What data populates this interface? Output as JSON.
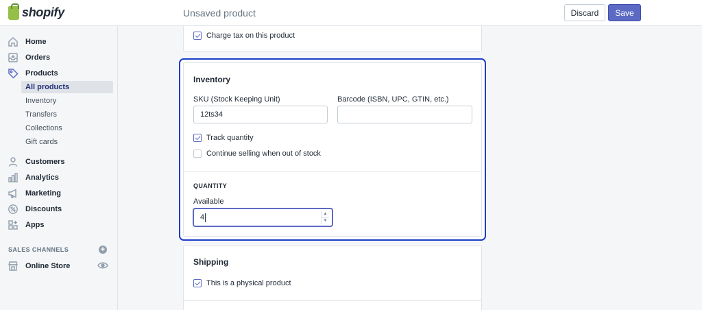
{
  "app": {
    "brand": "shopify",
    "page_title": "Unsaved product"
  },
  "actions": {
    "discard_label": "Discard",
    "save_label": "Save"
  },
  "sidebar": {
    "items": [
      {
        "label": "Home",
        "icon": "home-icon"
      },
      {
        "label": "Orders",
        "icon": "orders-icon"
      },
      {
        "label": "Products",
        "icon": "tag-icon"
      },
      {
        "label": "Customers",
        "icon": "person-icon"
      },
      {
        "label": "Analytics",
        "icon": "bar-chart-icon"
      },
      {
        "label": "Marketing",
        "icon": "megaphone-icon"
      },
      {
        "label": "Discounts",
        "icon": "discount-icon"
      },
      {
        "label": "Apps",
        "icon": "apps-icon"
      }
    ],
    "product_subitems": [
      "All products",
      "Inventory",
      "Transfers",
      "Collections",
      "Gift cards"
    ],
    "active_subitem": "All products",
    "sales_channels_title": "SALES CHANNELS",
    "channels": [
      {
        "label": "Online Store",
        "icon": "store-icon"
      }
    ]
  },
  "tax": {
    "label": "Charge tax on this product",
    "checked": true
  },
  "inventory": {
    "heading": "Inventory",
    "sku_label": "SKU (Stock Keeping Unit)",
    "sku_value": "12ts34",
    "barcode_label": "Barcode (ISBN, UPC, GTIN, etc.)",
    "barcode_value": "",
    "track_quantity_label": "Track quantity",
    "track_quantity_checked": true,
    "continue_selling_label": "Continue selling when out of stock",
    "continue_selling_checked": false,
    "quantity_title": "QUANTITY",
    "available_label": "Available",
    "available_value": "4"
  },
  "shipping": {
    "heading": "Shipping",
    "physical_label": "This is a physical product",
    "physical_checked": true
  },
  "colors": {
    "accent": "#5c6ac4",
    "focus": "#1b3ecb",
    "brand_green": "#95bf47"
  }
}
